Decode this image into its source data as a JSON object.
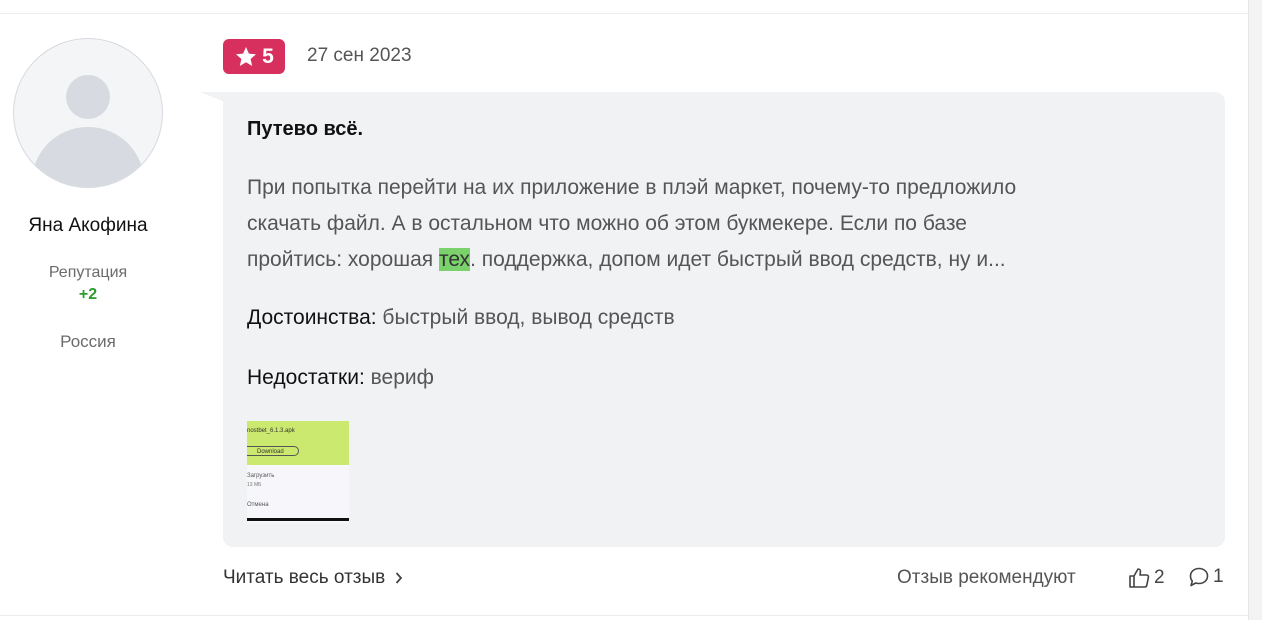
{
  "user": {
    "name": "Яна Акофина",
    "reputation_label": "Репутация",
    "reputation_value": "+2",
    "country": "Россия"
  },
  "review": {
    "rating": "5",
    "date": "27 сен 2023",
    "title": "Путево всё.",
    "text_lines": [
      "При попытка перейти на их приложение в плэй маркет, почему-то предложило",
      "скачать файл. А в остальном что можно об этом букмекере. Если по базе",
      "пройтись: хорошая "
    ],
    "highlight_word": "тех",
    "text_tail": ". поддержка, допом идет быстрый ввод средств, ну и...",
    "pros_label": "Достоинства:",
    "pros_value": " быстрый ввод, вывод средств",
    "cons_label": "Недостатки:",
    "cons_value": " вериф",
    "screenshot": {
      "file_name": "nostbet_6.1.3.apk",
      "download_label": "Download",
      "line1": "Загрузить",
      "line2": "13 МБ",
      "line3": "Отмена"
    }
  },
  "footer": {
    "read_more": "Читать весь отзыв",
    "recommend_label": "Отзыв рекомендуют",
    "likes_count": "2",
    "comments_count": "1"
  },
  "colors": {
    "rating_badge": "#d8305e",
    "highlight": "#7bd16b",
    "reputation": "#2c9a2c",
    "bubble": "#f1f2f4"
  },
  "icons": [
    "star-icon",
    "chevron-right-icon",
    "thumbs-up-icon",
    "comment-icon",
    "avatar-placeholder"
  ]
}
